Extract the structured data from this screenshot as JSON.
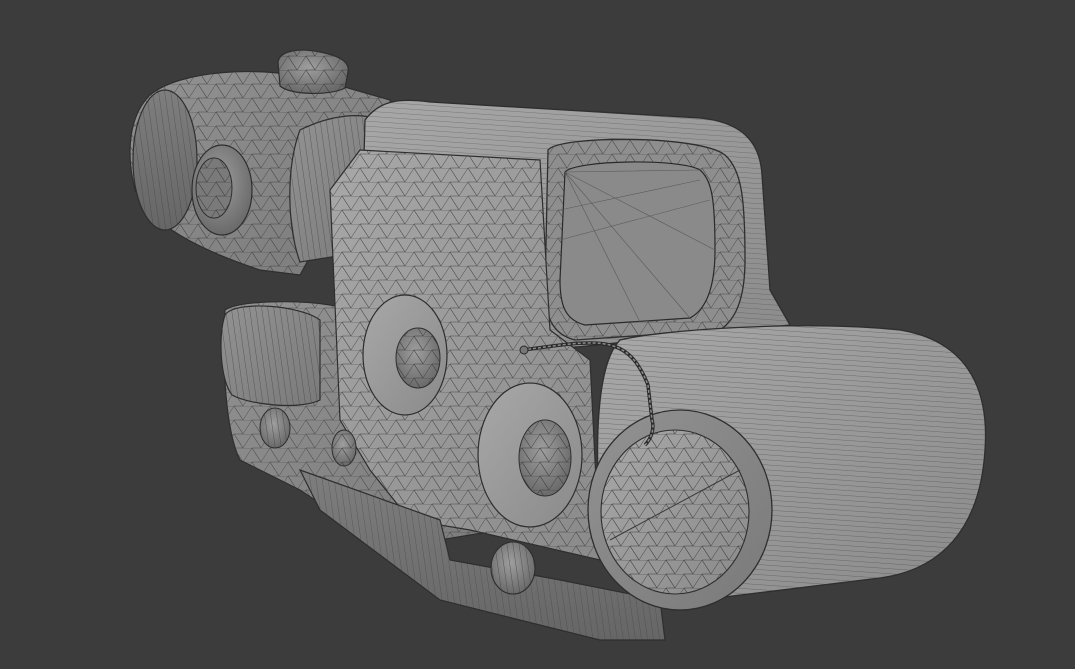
{
  "viewport": {
    "background": "#3c3c3c",
    "shading": "solid-gray-with-wireframe-overlay",
    "subject": "holographic-sight-3d-mesh"
  },
  "colors": {
    "surface_light": "#9a9a9a",
    "surface_mid": "#858585",
    "surface_dark": "#6e6e6e",
    "wire": "#2e2e2e",
    "window_inner": "#8c8c8c"
  }
}
